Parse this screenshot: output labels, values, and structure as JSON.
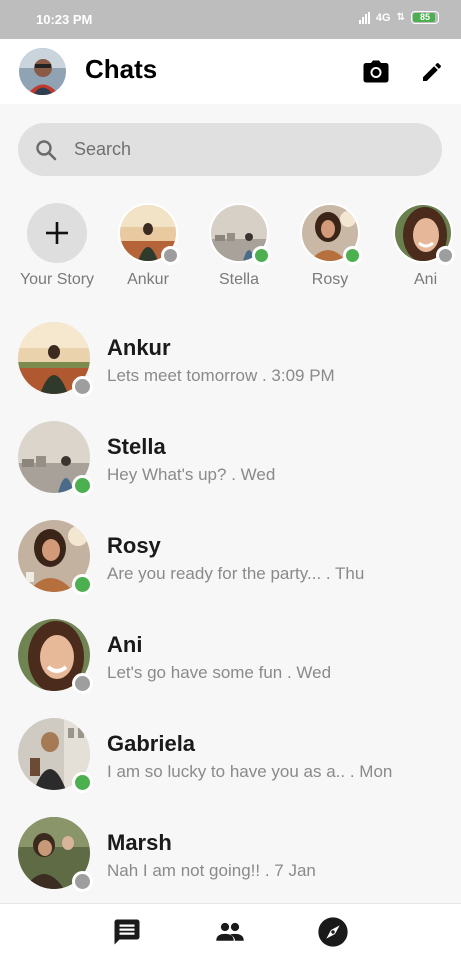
{
  "status": {
    "time": "10:23 PM",
    "network": "4G",
    "battery": "85"
  },
  "header": {
    "title": "Chats",
    "camera_icon": "camera-icon",
    "edit_icon": "edit-icon"
  },
  "search": {
    "placeholder": "Search"
  },
  "stories": [
    {
      "label": "Your Story"
    },
    {
      "label": "Ankur",
      "online": false
    },
    {
      "label": "Stella",
      "online": true
    },
    {
      "label": "Rosy",
      "online": true
    },
    {
      "label": "Ani",
      "online": false
    }
  ],
  "chats": [
    {
      "name": "Ankur",
      "message": "Lets meet tomorrow . 3:09 PM",
      "online": false
    },
    {
      "name": "Stella",
      "message": "Hey What's up? . Wed",
      "online": true
    },
    {
      "name": "Rosy",
      "message": "Are you ready for the party... . Thu",
      "online": true
    },
    {
      "name": "Ani",
      "message": "Let's go have some fun . Wed",
      "online": false
    },
    {
      "name": "Gabriela",
      "message": "I am so lucky to have you as a.. . Mon",
      "online": true
    },
    {
      "name": "Marsh",
      "message": "Nah I am not going!! . 7 Jan",
      "online": false
    }
  ],
  "colors": {
    "online": "#4caf50",
    "offline": "#9e9e9e",
    "accent": "#1a1a1a"
  },
  "nav": {
    "chats_icon": "chat-bubble-icon",
    "people_icon": "people-icon",
    "discover_icon": "compass-icon"
  }
}
